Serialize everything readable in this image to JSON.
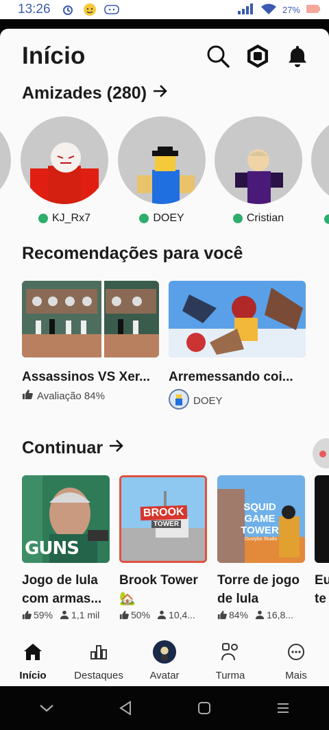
{
  "status_bar": {
    "time": "13:26",
    "battery": "27%"
  },
  "header": {
    "title": "Início",
    "icons": [
      "search-icon",
      "robux-icon",
      "bell-icon"
    ]
  },
  "friends": {
    "title": "Amizades (280)",
    "items": [
      {
        "name": "KJ_Rx7",
        "online": true
      },
      {
        "name": "DOEY",
        "online": true
      },
      {
        "name": "Cristian",
        "online": true
      }
    ]
  },
  "recommendations": {
    "title": "Recomendações para você",
    "items": [
      {
        "title": "Assassinos VS Xer...",
        "meta": "Avaliação 84%"
      },
      {
        "title": "Arremessando coi...",
        "meta": "DOEY"
      }
    ]
  },
  "continue": {
    "title": "Continuar",
    "items": [
      {
        "title": "Jogo de lula com armas...",
        "rating": "59%",
        "players": "1,1 mil",
        "thumb_text": "GUNS"
      },
      {
        "title": "Brook Tower 🏡",
        "rating": "50%",
        "players": "10,4...",
        "thumb_text": "BROOK",
        "thumb_sub": "TOWER"
      },
      {
        "title": "Torre de jogo de lula",
        "rating": "84%",
        "players": "16,8...",
        "thumb_text": "SQUID GAME TOWER",
        "thumb_sub": "Dustybo Studio"
      },
      {
        "title": "Eu te",
        "rating": "",
        "players": ""
      }
    ]
  },
  "bottom_nav": [
    {
      "label": "Início",
      "icon": "home-icon",
      "active": true
    },
    {
      "label": "Destaques",
      "icon": "chart-icon",
      "active": false
    },
    {
      "label": "Avatar",
      "icon": "avatar-icon",
      "active": false
    },
    {
      "label": "Turma",
      "icon": "group-icon",
      "active": false
    },
    {
      "label": "Mais",
      "icon": "more-icon",
      "active": false
    }
  ],
  "colors": {
    "online": "#2ead6d",
    "background": "#fafafa",
    "statusbar_text": "#3a5bb0"
  }
}
